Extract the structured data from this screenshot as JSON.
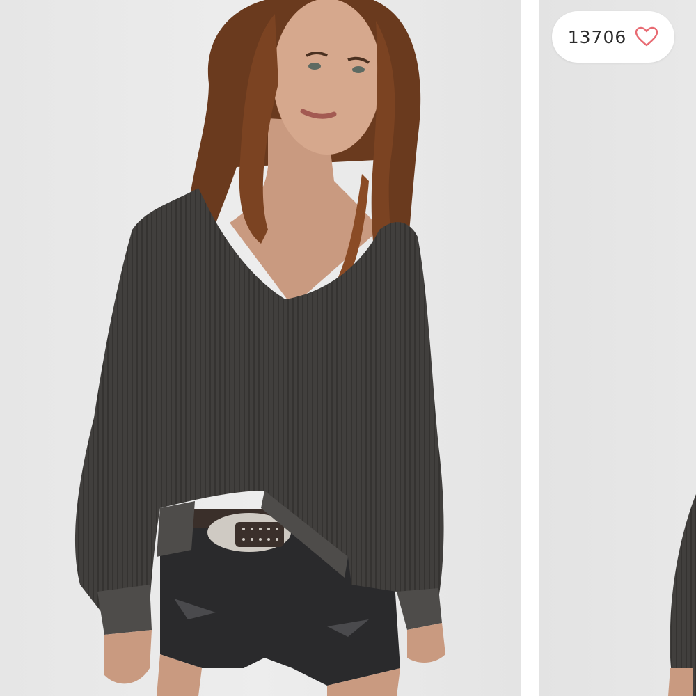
{
  "listing": {
    "like_count": "13706",
    "like_icon": "heart-outline-icon"
  },
  "colors": {
    "heart_stroke": "#e86a72",
    "background": "#e9e9e9",
    "sweater": "#3e3c3a",
    "shorts": "#2a2a2c"
  }
}
